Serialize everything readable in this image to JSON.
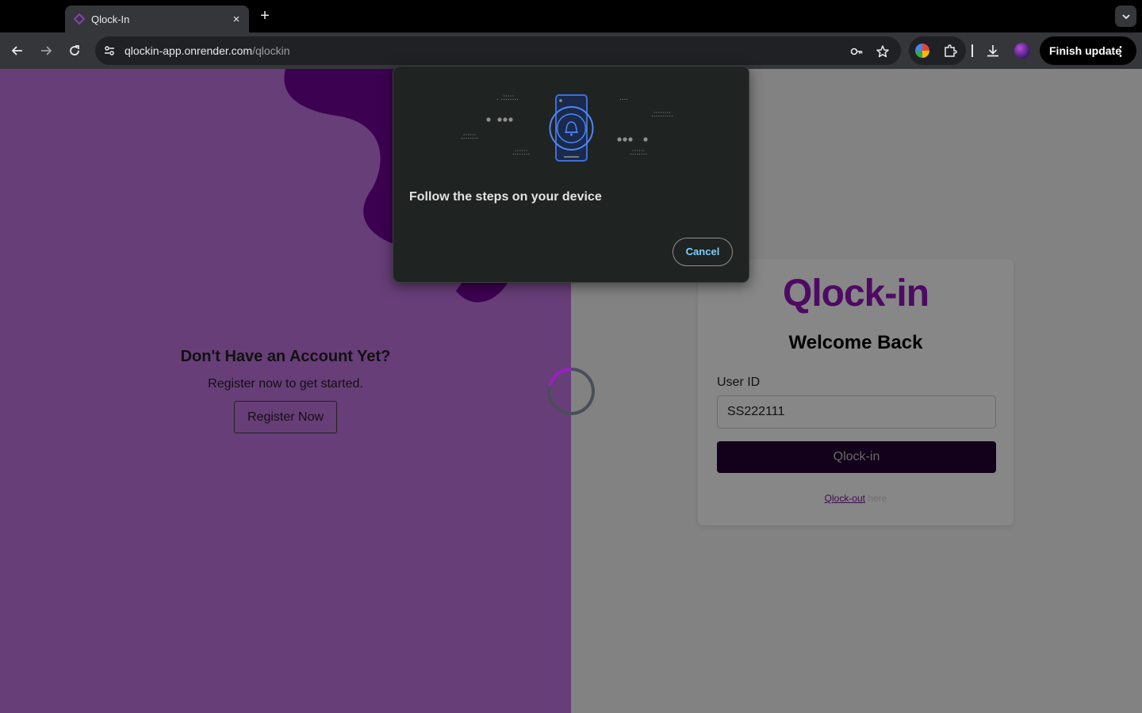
{
  "browser": {
    "tab_title": "Qlock-In",
    "close_tab": "×",
    "new_tab": "+",
    "url_host": "qlockin-app.onrender.com",
    "url_path": "/qlockin",
    "finish_update_label": "Finish update",
    "menu_dots": "⋮"
  },
  "left_pane": {
    "heading": "Don't Have an Account Yet?",
    "subtext": "Register now to get started.",
    "register_button": "Register Now",
    "background_color": "#673e78"
  },
  "login_card": {
    "logo_text": "Qlock-in",
    "welcome": "Welcome Back",
    "user_id_label": "User ID",
    "user_id_value": "SS222111",
    "submit_button": "Qlock-in",
    "qlockout_link": "Qlock-out",
    "qlockout_suffix": " here",
    "brand_color": "#4e0a63"
  },
  "dialog": {
    "heading": "Follow the steps on your device",
    "cancel_button": "Cancel",
    "icon": "phone-notification-icon"
  }
}
